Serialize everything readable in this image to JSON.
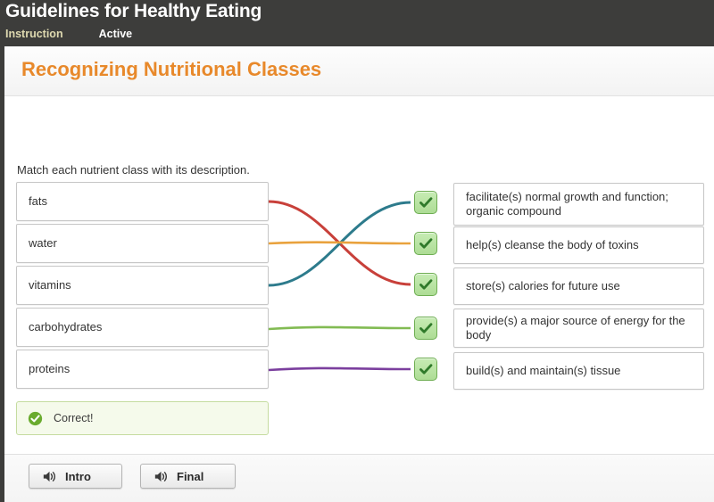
{
  "header": {
    "title": "Guidelines for Healthy Eating",
    "nav": [
      {
        "label": "Instruction",
        "state": "selected",
        "color": "#ded9b0"
      },
      {
        "label": "Active",
        "state": "normal",
        "color": "#ffffff"
      }
    ],
    "background": "#3d3d3b"
  },
  "page": {
    "title": "Recognizing Nutritional Classes",
    "title_color": "#e8892b",
    "prompt": "Match each nutrient class with its description."
  },
  "match": {
    "left_items": [
      {
        "label": "fats"
      },
      {
        "label": "water"
      },
      {
        "label": "vitamins"
      },
      {
        "label": "carbohydrates"
      },
      {
        "label": "proteins"
      }
    ],
    "right_items": [
      {
        "label": "facilitate(s) normal growth and function; organic compound"
      },
      {
        "label": "help(s) cleanse the body of toxins"
      },
      {
        "label": "store(s) calories for future use"
      },
      {
        "label": "provide(s) a major source of energy for the body"
      },
      {
        "label": "build(s) and maintain(s) tissue"
      }
    ],
    "badges": [
      {
        "icon": "check-icon",
        "state": "correct"
      },
      {
        "icon": "check-icon",
        "state": "correct"
      },
      {
        "icon": "check-icon",
        "state": "correct"
      },
      {
        "icon": "check-icon",
        "state": "correct"
      },
      {
        "icon": "check-icon",
        "state": "correct"
      }
    ],
    "connections": [
      {
        "from": "fats",
        "to": "store(s) calories for future use",
        "from_row": 1,
        "to_row": 3,
        "color": "#c8403a"
      },
      {
        "from": "water",
        "to": "help(s) cleanse the body of toxins",
        "from_row": 2,
        "to_row": 2,
        "color": "#e9a23d"
      },
      {
        "from": "vitamins",
        "to": "facilitate(s) normal growth and function; organic compound",
        "from_row": 3,
        "to_row": 1,
        "color": "#2d7b8c"
      },
      {
        "from": "carbohydrates",
        "to": "provide(s) a major source of energy for the body",
        "from_row": 4,
        "to_row": 4,
        "color": "#82bb53"
      },
      {
        "from": "proteins",
        "to": "build(s) and maintain(s) tissue",
        "from_row": 5,
        "to_row": 5,
        "color": "#7b3f9e"
      }
    ]
  },
  "feedback": {
    "text": "Correct!",
    "icon": "check-circle-icon",
    "background": "#f5faeb",
    "border": "#c5dca0"
  },
  "footer": {
    "buttons": [
      {
        "label": "Intro",
        "icon": "speaker-icon"
      },
      {
        "label": "Final",
        "icon": "speaker-icon"
      }
    ]
  }
}
